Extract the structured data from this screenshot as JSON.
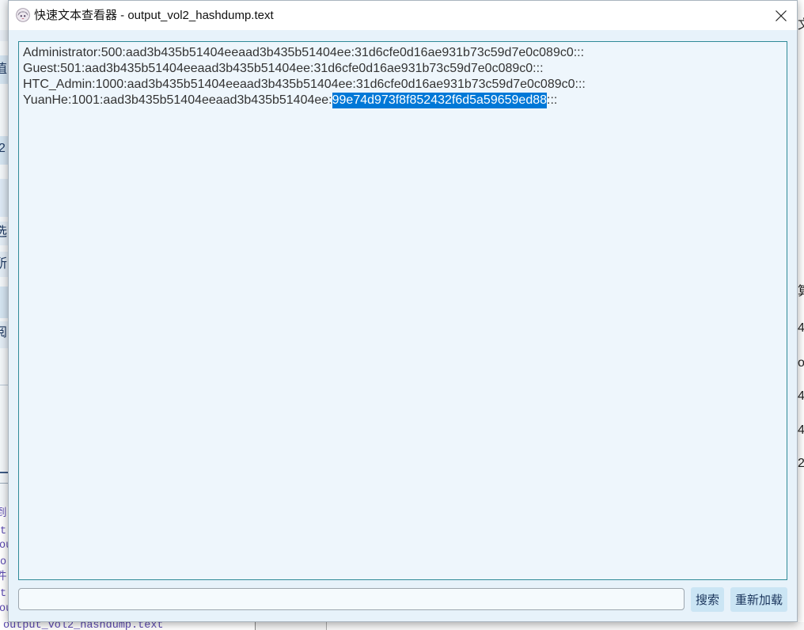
{
  "window": {
    "title": "快速文本查看器 - output_vol2_hashdump.text",
    "app_icon": "avatar-icon",
    "close_icon": "close-icon"
  },
  "content": {
    "lines": [
      {
        "text": "Administrator:500:aad3b435b51404eeaad3b435b51404ee:31d6cfe0d16ae931b73c59d7e0c089c0:::"
      },
      {
        "text": "Guest:501:aad3b435b51404eeaad3b435b51404ee:31d6cfe0d16ae931b73c59d7e0c089c0:::"
      },
      {
        "text": "HTC_Admin:1000:aad3b435b51404eeaad3b435b51404ee:31d6cfe0d16ae931b73c59d7e0c089c0:::"
      },
      {
        "before": "YuanHe:1001:aad3b435b51404eeaad3b435b51404ee:",
        "selected": "99e74d973f8f852432f6d5a59659ed88",
        "after": ":::"
      }
    ]
  },
  "search": {
    "value": ""
  },
  "buttons": {
    "search_label": "搜索",
    "reload_label": "重新加载"
  },
  "colors": {
    "selection_bg": "#0078d7",
    "selection_text": "#ffffff",
    "text_area_border": "#2f8a98",
    "text_area_bg": "#eef6fc",
    "window_body": "#e7f2fa",
    "button_bg": "#cbe5f4",
    "button_text": "#1b365d"
  },
  "background": {
    "left_fragments": [
      "值",
      "2",
      "选",
      "所",
      "阅"
    ],
    "log_fragments": [
      "到",
      "t",
      "ou",
      "o",
      "件",
      "t",
      "ou"
    ],
    "right_fragments": [
      "文",
      "算",
      "4",
      "o",
      "4",
      "4",
      "2"
    ],
    "bottom_filename": "output_vol2_hashdump.text"
  }
}
